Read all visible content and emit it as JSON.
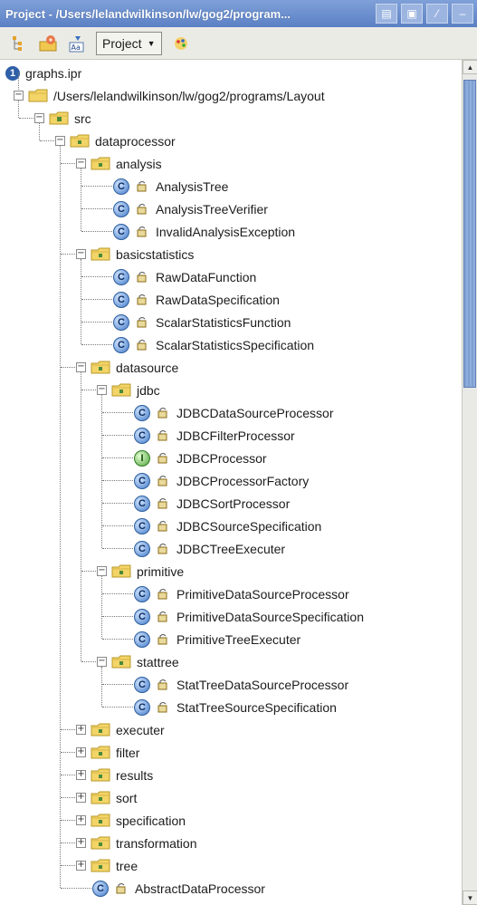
{
  "window": {
    "title": "Project - /Users/lelandwilkinson/lw/gog2/program...",
    "buttons": [
      {
        "name": "window-menu-icon",
        "glyph": "▤"
      },
      {
        "name": "restore-icon",
        "glyph": "▣"
      },
      {
        "name": "pin-icon",
        "glyph": "⁄"
      },
      {
        "name": "minimize-icon",
        "glyph": "–"
      }
    ]
  },
  "toolbar": {
    "icons": [
      "structure-icon",
      "autoscroll-icon",
      "sort-alpha-icon"
    ],
    "project_dropdown": "Project",
    "settings_icon": "palette-icon"
  },
  "tree": {
    "root": "graphs.ipr",
    "nodes": [
      {
        "label": "/Users/lelandwilkinson/lw/gog2/programs/Layout",
        "type": "folder-plain",
        "depth": 0,
        "expanded": true
      },
      {
        "label": "src",
        "type": "folder-src",
        "depth": 1,
        "expanded": true
      },
      {
        "label": "dataprocessor",
        "type": "folder-pkg",
        "depth": 2,
        "expanded": true
      },
      {
        "label": "analysis",
        "type": "folder-pkg",
        "depth": 3,
        "expanded": true
      },
      {
        "label": "AnalysisTree",
        "type": "class",
        "depth": 4
      },
      {
        "label": "AnalysisTreeVerifier",
        "type": "class",
        "depth": 4
      },
      {
        "label": "InvalidAnalysisException",
        "type": "class",
        "depth": 4
      },
      {
        "label": "basicstatistics",
        "type": "folder-pkg",
        "depth": 3,
        "expanded": true
      },
      {
        "label": "RawDataFunction",
        "type": "class",
        "depth": 4
      },
      {
        "label": "RawDataSpecification",
        "type": "class",
        "depth": 4
      },
      {
        "label": "ScalarStatisticsFunction",
        "type": "class",
        "depth": 4
      },
      {
        "label": "ScalarStatisticsSpecification",
        "type": "class",
        "depth": 4
      },
      {
        "label": "datasource",
        "type": "folder-pkg",
        "depth": 3,
        "expanded": true
      },
      {
        "label": "jdbc",
        "type": "folder-pkg",
        "depth": 4,
        "expanded": true
      },
      {
        "label": "JDBCDataSourceProcessor",
        "type": "class",
        "depth": 5
      },
      {
        "label": "JDBCFilterProcessor",
        "type": "class",
        "depth": 5
      },
      {
        "label": "JDBCProcessor",
        "type": "interface",
        "depth": 5
      },
      {
        "label": "JDBCProcessorFactory",
        "type": "class",
        "depth": 5
      },
      {
        "label": "JDBCSortProcessor",
        "type": "class",
        "depth": 5
      },
      {
        "label": "JDBCSourceSpecification",
        "type": "class",
        "depth": 5
      },
      {
        "label": "JDBCTreeExecuter",
        "type": "class",
        "depth": 5
      },
      {
        "label": "primitive",
        "type": "folder-pkg",
        "depth": 4,
        "expanded": true
      },
      {
        "label": "PrimitiveDataSourceProcessor",
        "type": "class",
        "depth": 5
      },
      {
        "label": "PrimitiveDataSourceSpecification",
        "type": "class",
        "depth": 5
      },
      {
        "label": "PrimitiveTreeExecuter",
        "type": "class",
        "depth": 5
      },
      {
        "label": "stattree",
        "type": "folder-pkg",
        "depth": 4,
        "expanded": true
      },
      {
        "label": "StatTreeDataSourceProcessor",
        "type": "class",
        "depth": 5
      },
      {
        "label": "StatTreeSourceSpecification",
        "type": "class",
        "depth": 5
      },
      {
        "label": "executer",
        "type": "folder-pkg",
        "depth": 3,
        "expanded": false
      },
      {
        "label": "filter",
        "type": "folder-pkg",
        "depth": 3,
        "expanded": false
      },
      {
        "label": "results",
        "type": "folder-pkg",
        "depth": 3,
        "expanded": false
      },
      {
        "label": "sort",
        "type": "folder-pkg",
        "depth": 3,
        "expanded": false
      },
      {
        "label": "specification",
        "type": "folder-pkg",
        "depth": 3,
        "expanded": false
      },
      {
        "label": "transformation",
        "type": "folder-pkg",
        "depth": 3,
        "expanded": false
      },
      {
        "label": "tree",
        "type": "folder-pkg",
        "depth": 3,
        "expanded": false
      },
      {
        "label": "AbstractDataProcessor",
        "type": "class",
        "depth": 3
      }
    ]
  },
  "colors": {
    "title_bar": "#6b8fd0",
    "folder": "#f0d060",
    "package_dot": "#4a8a3a",
    "class_icon": "#3f78c8",
    "interface_icon": "#4ca23a"
  }
}
